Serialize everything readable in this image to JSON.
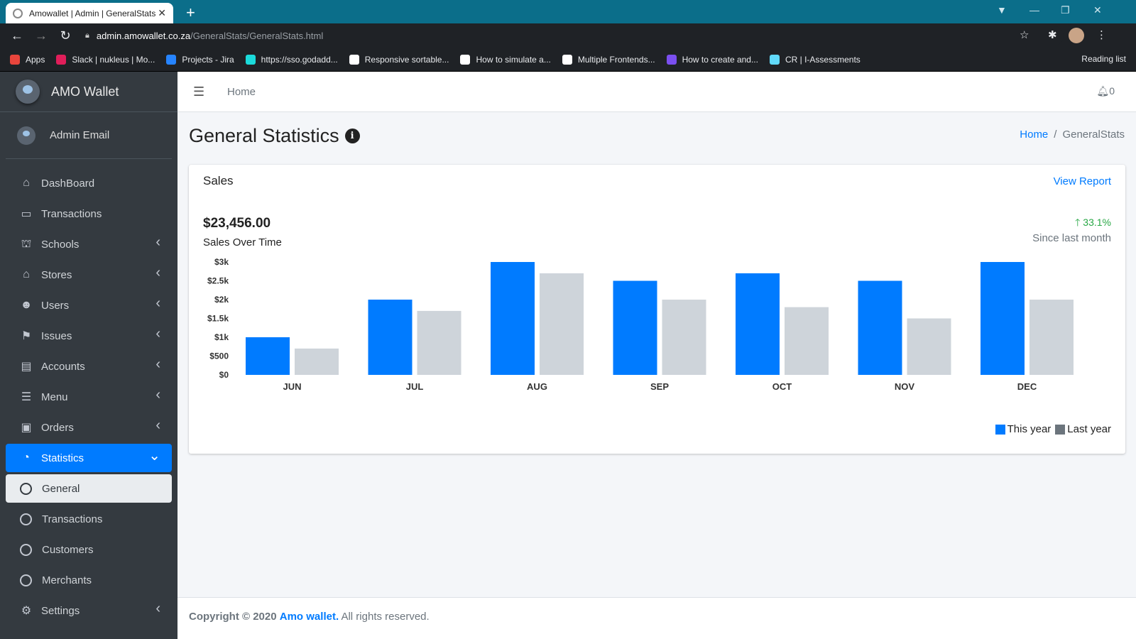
{
  "browser": {
    "tab_title": "Amowallet | Admin | GeneralStats",
    "url_host": "admin.amowallet.co.za",
    "url_path": "/GeneralStats/GeneralStats.html",
    "bookmarks": [
      {
        "label": "Apps",
        "color": "#e8453c"
      },
      {
        "label": "Slack | nukleus | Mo...",
        "color": "#e01e5a"
      },
      {
        "label": "Projects - Jira",
        "color": "#2684ff"
      },
      {
        "label": "https://sso.godadd...",
        "color": "#1bdbdb"
      },
      {
        "label": "Responsive sortable...",
        "color": "#ffffff"
      },
      {
        "label": "How to simulate a...",
        "color": "#ffffff"
      },
      {
        "label": "Multiple Frontends...",
        "color": "#ffffff"
      },
      {
        "label": "How to create and...",
        "color": "#7b4ff0"
      },
      {
        "label": "CR | I-Assessments",
        "color": "#61dafb"
      }
    ],
    "reading_list": "Reading list"
  },
  "sidebar": {
    "brand": "AMO Wallet",
    "user": "Admin Email",
    "items": [
      {
        "label": "DashBoard",
        "icon": "home-icon",
        "glyph": "⌂",
        "chevron": ""
      },
      {
        "label": "Transactions",
        "icon": "credit-card-icon",
        "glyph": "▭",
        "chevron": ""
      },
      {
        "label": "Schools",
        "icon": "school-icon",
        "glyph": "⛫",
        "chevron": "❮"
      },
      {
        "label": "Stores",
        "icon": "store-icon",
        "glyph": "⌂",
        "chevron": "❮"
      },
      {
        "label": "Users",
        "icon": "users-icon",
        "glyph": "☻",
        "chevron": "❮"
      },
      {
        "label": "Issues",
        "icon": "flag-icon",
        "glyph": "⚑",
        "chevron": "❮"
      },
      {
        "label": "Accounts",
        "icon": "wallet-icon",
        "glyph": "▤",
        "chevron": "❮"
      },
      {
        "label": "Menu",
        "icon": "list-icon",
        "glyph": "☰",
        "chevron": "❮"
      },
      {
        "label": "Orders",
        "icon": "shopping-bag-icon",
        "glyph": "▣",
        "chevron": "❮"
      },
      {
        "label": "Statistics",
        "icon": "pie-chart-icon",
        "glyph": "◔",
        "chevron": "❯"
      }
    ],
    "sub_items": [
      {
        "label": "General"
      },
      {
        "label": "Transactions"
      },
      {
        "label": "Customers"
      },
      {
        "label": "Merchants"
      }
    ],
    "settings": {
      "label": "Settings",
      "icon": "cogs-icon",
      "glyph": "⚙",
      "chevron": "❮"
    }
  },
  "topnav": {
    "home": "Home",
    "notifications": "0"
  },
  "page": {
    "title": "General Statistics",
    "breadcrumb_home": "Home",
    "breadcrumb_sep": "/",
    "breadcrumb_current": "GeneralStats"
  },
  "card": {
    "title": "Sales",
    "view_report": "View Report",
    "amount": "$23,456.00",
    "subtitle": "Sales Over Time",
    "change": "33.1%",
    "since": "Since last month"
  },
  "chart_data": {
    "type": "bar",
    "categories": [
      "JUN",
      "JUL",
      "AUG",
      "SEP",
      "OCT",
      "NOV",
      "DEC"
    ],
    "series": [
      {
        "name": "This year",
        "color": "#007bff",
        "values": [
          1000,
          2000,
          3000,
          2500,
          2700,
          2500,
          3000
        ]
      },
      {
        "name": "Last year",
        "color": "#ced4da",
        "values": [
          700,
          1700,
          2700,
          2000,
          1800,
          1500,
          2000
        ]
      }
    ],
    "yticks": [
      "$0",
      "$500",
      "$1k",
      "$1.5k",
      "$2k",
      "$2.5k",
      "$3k"
    ],
    "ylim": [
      0,
      3000
    ],
    "grid": false,
    "legend": "bottom-right",
    "legend_colors": [
      "#007bff",
      "#6c757d"
    ]
  },
  "footer": {
    "prefix": "Copyright © 2020",
    "brand": "Amo wallet.",
    "suffix": "All rights reserved."
  }
}
